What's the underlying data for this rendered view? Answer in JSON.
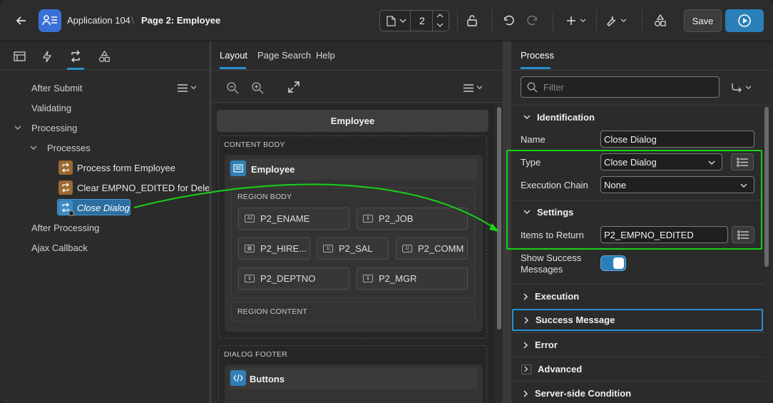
{
  "topbar": {
    "app_name": "Application 104",
    "breadcrumb_sep": "\\",
    "page_name": "Page 2: Employee",
    "page_number": "2",
    "save_label": "Save"
  },
  "left": {
    "tree": [
      {
        "label": "After Submit"
      },
      {
        "label": "Validating"
      },
      {
        "label": "Processing"
      },
      {
        "label": "Processes"
      },
      {
        "label": "Process form Employee"
      },
      {
        "label": "Clear EMPNO_EDITED for Delete"
      },
      {
        "label": "Close Dialog"
      },
      {
        "label": "After Processing"
      },
      {
        "label": "Ajax Callback"
      }
    ]
  },
  "middle": {
    "tabs": [
      "Layout",
      "Page Search",
      "Help"
    ],
    "dialog_title": "Employee",
    "content_body": "CONTENT BODY",
    "region_title": "Employee",
    "region_body": "REGION BODY",
    "items": [
      "P2_ENAME",
      "P2_JOB",
      "P2_HIRE...",
      "P2_SAL",
      "P2_COMM",
      "P2_DEPTNO",
      "P2_MGR"
    ],
    "region_content": "REGION CONTENT",
    "dialog_footer": "DIALOG FOOTER",
    "buttons_region": "Buttons"
  },
  "right": {
    "tab": "Process",
    "filter_placeholder": "Filter",
    "sections": {
      "identification": "Identification",
      "settings": "Settings",
      "execution": "Execution",
      "success_message": "Success Message",
      "error": "Error",
      "advanced": "Advanced",
      "server_side": "Server-side Condition"
    },
    "fields": {
      "name_label": "Name",
      "name_value": "Close Dialog",
      "type_label": "Type",
      "type_value": "Close Dialog",
      "exec_chain_label": "Execution Chain",
      "exec_chain_value": "None",
      "items_label": "Items to Return",
      "items_value": "P2_EMPNO_EDITED",
      "show_success_label_1": "Show Success",
      "show_success_label_2": "Messages"
    }
  },
  "colors": {
    "accent": "#2a7fb8",
    "highlight": "#19d119"
  }
}
